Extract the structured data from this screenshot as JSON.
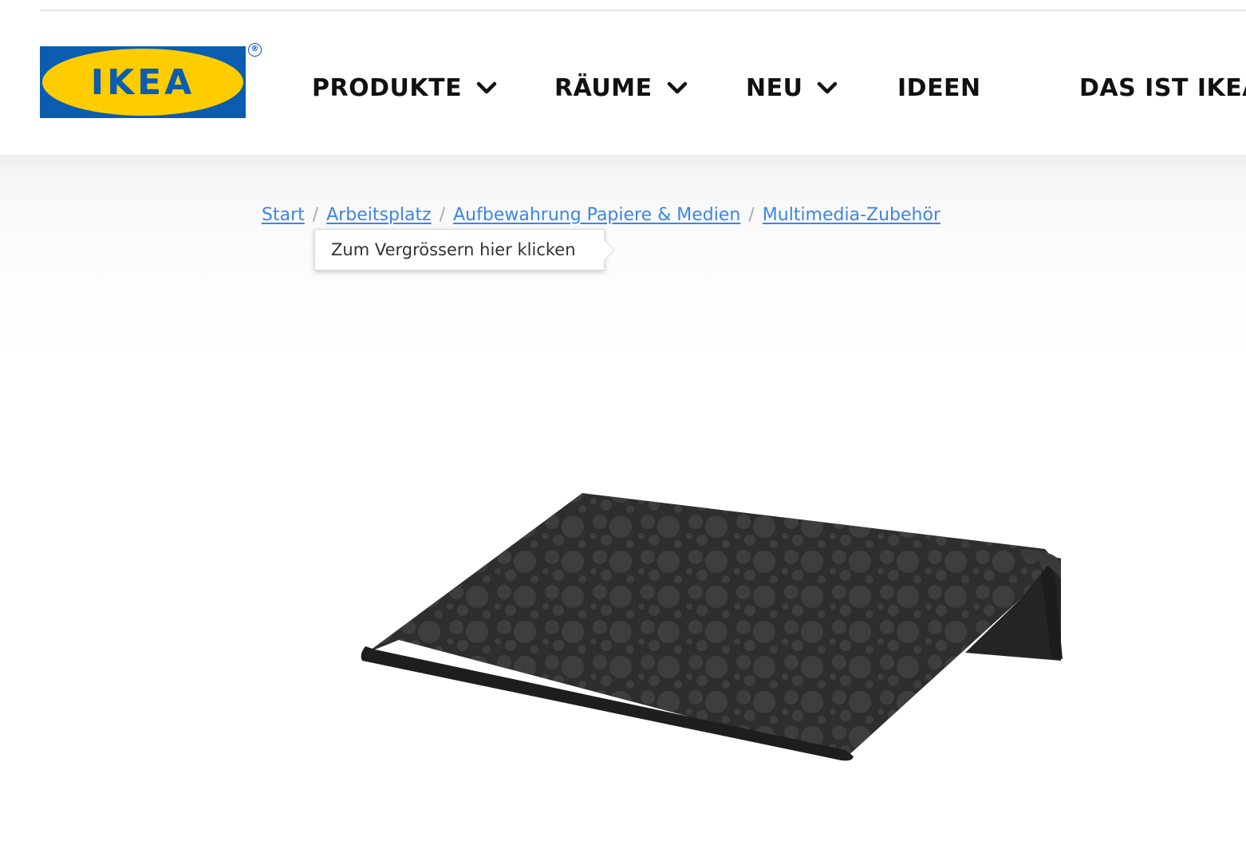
{
  "brand": {
    "name": "IKEA",
    "logo_text": "IKEA",
    "registered_mark": "®",
    "colors": {
      "blue": "#0a5db0",
      "yellow": "#ffcc00",
      "text": "#111111",
      "link": "#3a86e6"
    }
  },
  "nav": {
    "items": [
      {
        "label": "PRODUKTE",
        "icon": "chevron-down-icon"
      },
      {
        "label": "RÄUME",
        "icon": "chevron-down-icon"
      },
      {
        "label": "NEU",
        "icon": "chevron-down-icon"
      },
      {
        "label": "IDEEN"
      },
      {
        "label": "DAS IST IKEA"
      }
    ]
  },
  "breadcrumb": {
    "separator": "/",
    "items": [
      "Start",
      "Arbeitsplatz",
      "Aufbewahrung Papiere & Medien",
      "Multimedia-Zubehör"
    ]
  },
  "tooltip": {
    "text": "Zum Vergrössern hier klicken"
  },
  "product_image": {
    "subject": "black laptop stand with circle pattern",
    "color": "#2e2e2e"
  }
}
